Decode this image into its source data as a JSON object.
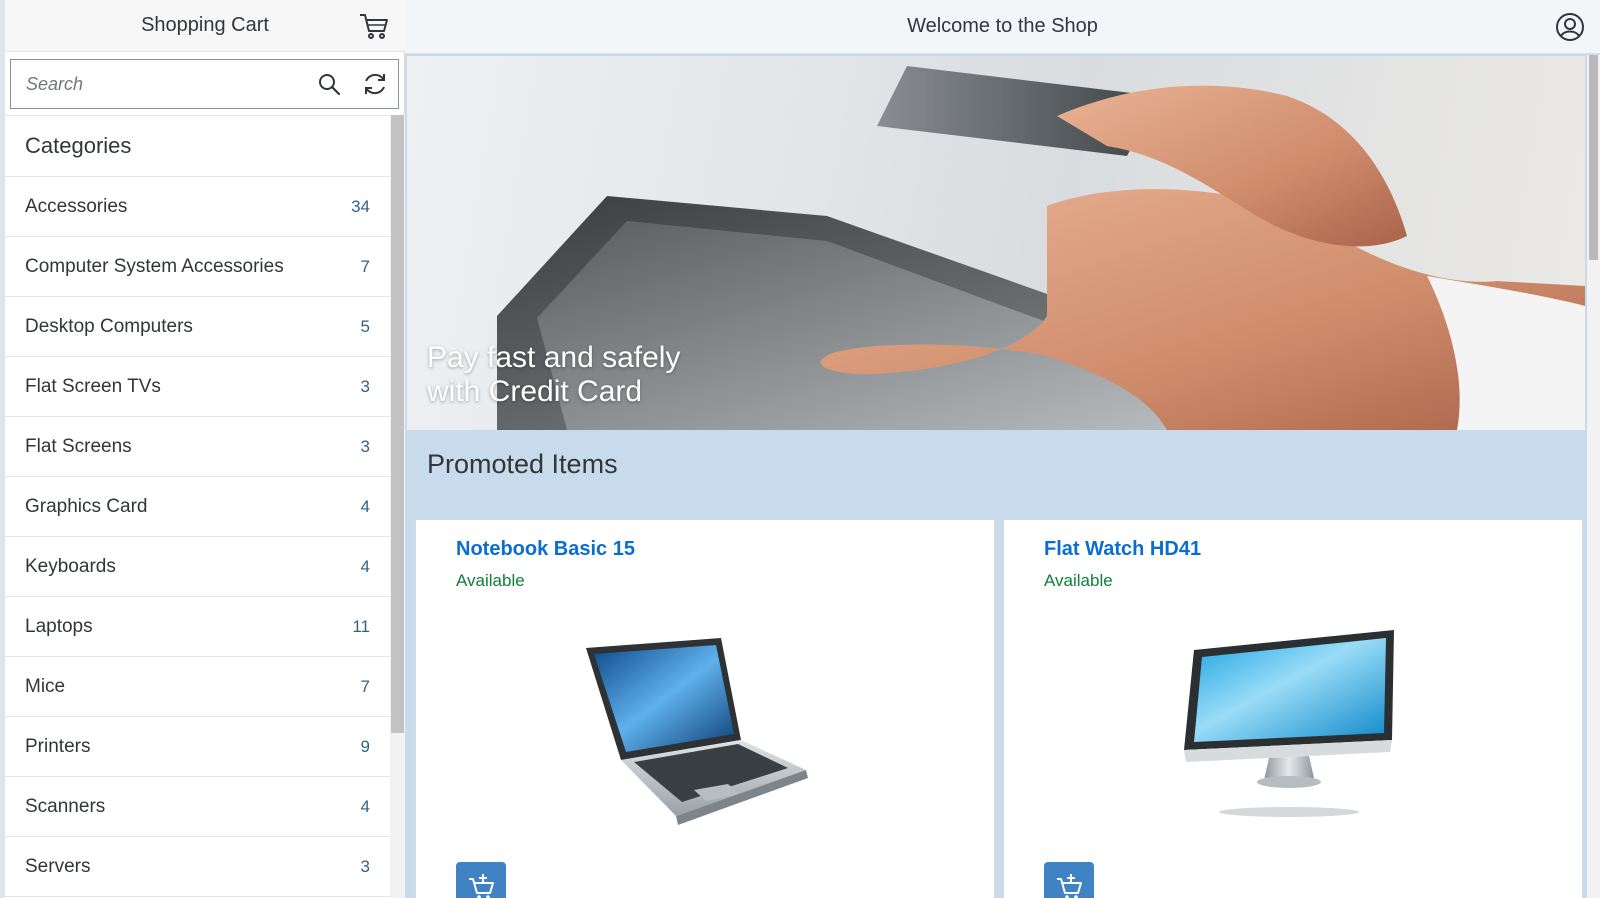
{
  "master": {
    "title": "Shopping Cart",
    "cart_icon": "cart-icon",
    "search": {
      "placeholder": "Search",
      "value": ""
    },
    "categories_header": "Categories",
    "categories": [
      {
        "label": "Accessories",
        "count": "34"
      },
      {
        "label": "Computer System Accessories",
        "count": "7"
      },
      {
        "label": "Desktop Computers",
        "count": "5"
      },
      {
        "label": "Flat Screen TVs",
        "count": "3"
      },
      {
        "label": "Flat Screens",
        "count": "3"
      },
      {
        "label": "Graphics Card",
        "count": "4"
      },
      {
        "label": "Keyboards",
        "count": "4"
      },
      {
        "label": "Laptops",
        "count": "11"
      },
      {
        "label": "Mice",
        "count": "7"
      },
      {
        "label": "Printers",
        "count": "9"
      },
      {
        "label": "Scanners",
        "count": "4"
      },
      {
        "label": "Servers",
        "count": "3"
      }
    ]
  },
  "detail": {
    "title": "Welcome to the Shop",
    "banner": {
      "line1": "Pay fast and safely",
      "line2": "with Credit Card"
    },
    "promoted_title": "Promoted Items",
    "items": [
      {
        "name": "Notebook Basic 15",
        "status": "Available",
        "image": "laptop"
      },
      {
        "name": "Flat Watch HD41",
        "status": "Available",
        "image": "monitor"
      }
    ]
  },
  "colors": {
    "accent": "#0a6ed1",
    "available": "#107e3e",
    "detail_background": "#c7dbec",
    "button": "#3f83c4"
  }
}
